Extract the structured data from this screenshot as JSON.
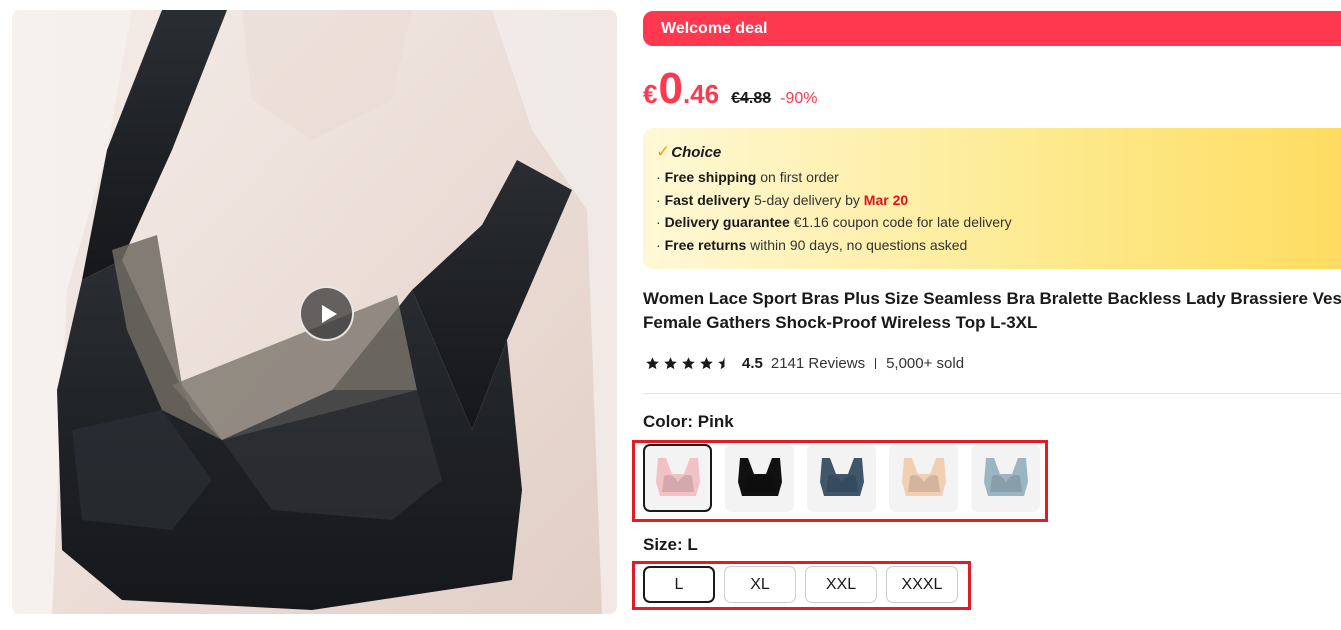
{
  "product_image": {
    "alt": "Black seamless bra with sheer mesh V panel"
  },
  "banner": {
    "text": "Welcome deal"
  },
  "price": {
    "currency": "€",
    "integer": "0",
    "decimal": ".46",
    "original": "€4.88",
    "discount": "-90%"
  },
  "choice": {
    "brand": "Choice",
    "items": [
      {
        "bold": "Free shipping",
        "text": " on first order"
      },
      {
        "bold": "Fast delivery",
        "text": " 5-day delivery by ",
        "red": "Mar 20"
      },
      {
        "bold": "Delivery guarantee",
        "text": "  €1.16 coupon code for late delivery"
      },
      {
        "bold": "Free returns",
        "text": "  within 90 days, no questions asked"
      }
    ]
  },
  "title": {
    "line1": "Women Lace Sport Bras Plus Size Seamless Bra Bralette Backless Lady Brassiere Vest",
    "line2": "Female Gathers Shock-Proof Wireless Top L-3XL"
  },
  "rating": {
    "stars": 4.5,
    "value": "4.5",
    "reviews": "2141 Reviews",
    "sold": "5,000+ sold"
  },
  "color": {
    "label": "Color: Pink",
    "options": [
      {
        "name": "Pink",
        "hex": "#f2c1c6",
        "selected": true
      },
      {
        "name": "Black",
        "hex": "#111111",
        "selected": false
      },
      {
        "name": "Navy Blue",
        "hex": "#3f566b",
        "selected": false
      },
      {
        "name": "Beige",
        "hex": "#f1cfb3",
        "selected": false
      },
      {
        "name": "Light Blue",
        "hex": "#9bb6c2",
        "selected": false
      }
    ]
  },
  "size": {
    "label": "Size: L",
    "options": [
      "L",
      "XL",
      "XXL",
      "XXXL"
    ],
    "selected": "L"
  },
  "colors": {
    "accent": "#fd384f",
    "highlight": "#e01c25"
  }
}
